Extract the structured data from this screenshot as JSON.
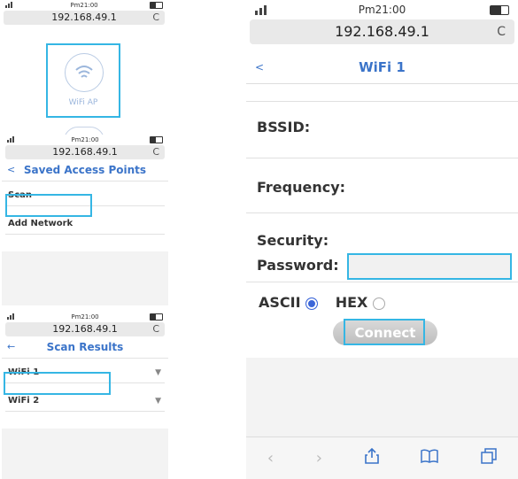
{
  "status": {
    "time": "Pm21:00"
  },
  "address": {
    "url": "192.168.49.1",
    "reload_glyph": "C"
  },
  "screen1": {
    "ap_label": "WiFi AP"
  },
  "screen2": {
    "back": "<",
    "title": "Saved Access Points",
    "items": [
      "Scan",
      "Add Network"
    ]
  },
  "screen3": {
    "back": "←",
    "title": "Scan Results",
    "items": [
      "WiFi 1",
      "WiFi 2"
    ]
  },
  "screen4": {
    "back": "<",
    "title": "WiFi 1",
    "bssid_label": "BSSID:",
    "frequency_label": "Frequency:",
    "security_label": "Security:",
    "password_label": "Password:",
    "password_value": "",
    "ascii_label": "ASCII",
    "hex_label": "HEX",
    "selected_encoding": "ASCII",
    "connect_label": "Connect",
    "toolbar_icons": [
      "back-icon",
      "forward-icon",
      "share-icon",
      "bookmarks-icon",
      "tabs-icon"
    ]
  },
  "colors": {
    "accent": "#3b74c9",
    "highlight": "#35b6e4",
    "radio_selected": "#3b66d8"
  }
}
